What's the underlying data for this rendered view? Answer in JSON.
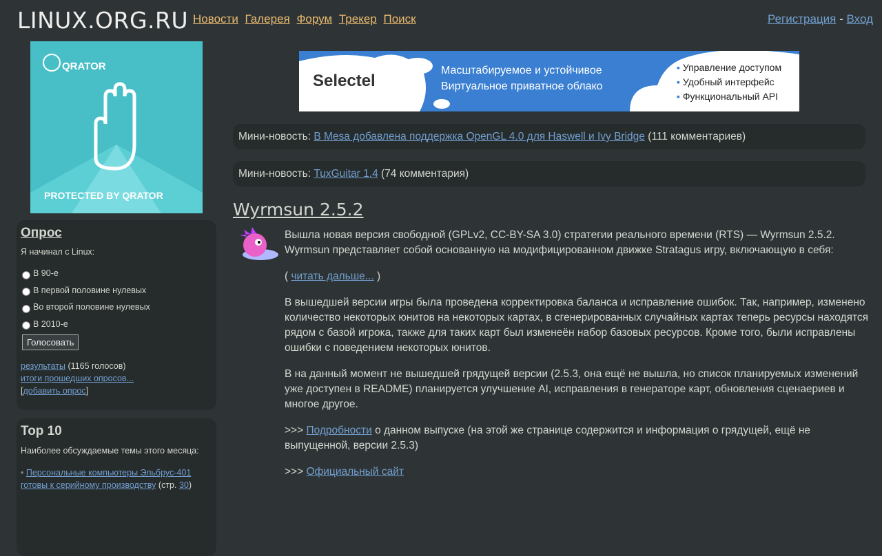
{
  "header": {
    "logo": "LINUX.ORG.RU",
    "nav": [
      "Новости",
      "Галерея",
      "Форум",
      "Трекер",
      "Поиск"
    ],
    "register": "Регистрация",
    "separator": "-",
    "login": "Вход"
  },
  "left_banner": {
    "brand": "QRATOR",
    "caption": "PROTECTED BY QRATOR"
  },
  "poll": {
    "title": "Опрос",
    "question": "Я начинал с Linux:",
    "options": [
      "В 90-е",
      "В первой половине нулевых",
      "Во второй половине нулевых",
      "В 2010-е"
    ],
    "vote_button": "Голосовать",
    "results_link": "результаты",
    "votes": "(1165 голосов)",
    "past_link": "итоги прошедших опросов...",
    "add_open": "[",
    "add_link": "добавить опрос",
    "add_close": "]"
  },
  "top10": {
    "title": "Top 10",
    "subtitle": "Наиболее обсуждаемые темы этого месяца:",
    "item_link": "Персональные компьютеры Эльбрус-401 готовы к серийному производству",
    "item_pages_prefix": "(стр.",
    "item_page": "30",
    "item_pages_suffix": ")"
  },
  "ad": {
    "brand": "Selectel",
    "line1": "Масштабируемое и устойчивое",
    "line2": "Виртуальное приватное облако",
    "features": [
      "Управление доступом",
      "Удобный интерфейс",
      "Функциональный API"
    ]
  },
  "mini_news": [
    {
      "label": "Мини-новость:",
      "link": "В Mesa добавлена поддержка OpenGL 4.0 для Haswell и Ivy Bridge",
      "comments": "(111 комментариев)"
    },
    {
      "label": "Мини-новость:",
      "link": "TuxGuitar 1.4",
      "comments": "(74 комментария)"
    }
  ],
  "article": {
    "title": "Wyrmsun 2.5.2",
    "p1": "Вышла новая версия свободной (GPLv2, CC-BY-SA 3.0) стратегии реального времени (RTS) — Wyrmsun 2.5.2. Wyrmsun представляет собой основанную на модифицированном движке Stratagus игру, включающую в себя:",
    "read_more_open": "(",
    "read_more": "читать дальше...",
    "read_more_close": ")",
    "p2": "В вышедшей версии игры была проведена корректировка баланса и исправление ошибок. Так, например, изменено количество некоторых юнитов на некоторых картах, в сгенерированных случайных картах теперь ресурсы находятся рядом с базой игрока, также для таких карт был изменеён набор базовых ресурсов. Кроме того, были исправлены ошибки с поведением некоторых юнитов.",
    "p3": "В на данный момент не вышедшей грядущей версии (2.5.3, она ещё не вышла, но список планируемых изменений уже доступен в README) планируется улучшение AI, исправления в генераторе карт, обновления сценаериев и многое другое.",
    "p4_prefix": ">>>",
    "p4_link": "Подробности",
    "p4_text": "о данном выпуске (на этой же странице содержится и информация о грядущей, ещё не выпущенной, версии 2.5.3)",
    "p5_prefix": ">>>",
    "p5_link": "Официальный сайт"
  }
}
